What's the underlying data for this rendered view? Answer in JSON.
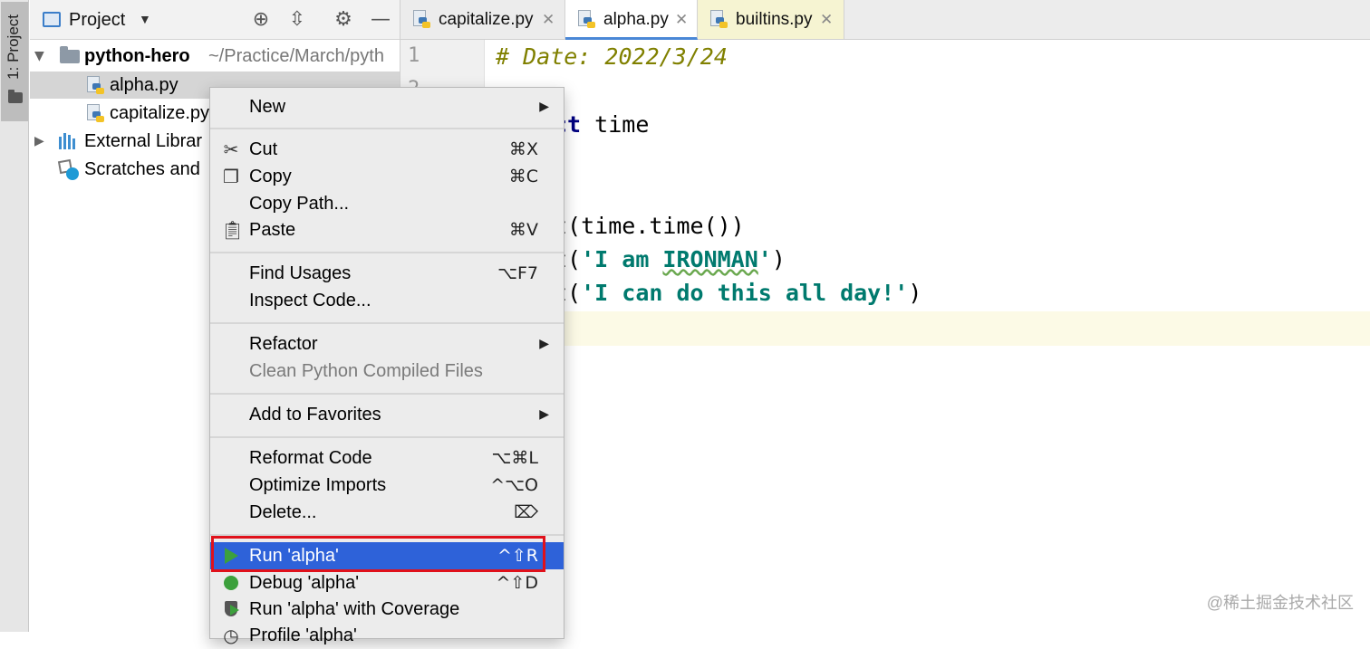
{
  "tool_window": {
    "label": "1: Project"
  },
  "project_panel": {
    "title": "Project",
    "tree": [
      {
        "name": "python-hero",
        "path": "~/Practice/March/pyth"
      },
      {
        "name": "alpha.py"
      },
      {
        "name": "capitalize.py"
      },
      {
        "name": "External Librar"
      },
      {
        "name": "Scratches and"
      }
    ]
  },
  "tabs": [
    {
      "label": "capitalize.py"
    },
    {
      "label": "alpha.py"
    },
    {
      "label": "builtins.py"
    }
  ],
  "editor": {
    "line_numbers": [
      "1",
      "2"
    ],
    "code": {
      "comment": "# Date: 2022/3/24",
      "import_kw": "ct",
      "import_rest": " time",
      "print1_rest": "t(time.time())",
      "print2_tail": "t(",
      "print2_str_a": "'I am ",
      "print2_str_b": "IRONMAN",
      "print2_str_c": "'",
      "print2_close": ")",
      "print3_tail": "t(",
      "print3_str": "'I can do this all day!'",
      "print3_close": ")"
    }
  },
  "context_menu": {
    "items": {
      "new": {
        "label": "New"
      },
      "cut": {
        "label": "Cut",
        "shortcut": "⌘X"
      },
      "copy": {
        "label": "Copy",
        "shortcut": "⌘C"
      },
      "copy_path": {
        "label": "Copy Path..."
      },
      "paste": {
        "label": "Paste",
        "shortcut": "⌘V"
      },
      "find_usages": {
        "label": "Find Usages",
        "shortcut": "⌥F7"
      },
      "inspect_code": {
        "label": "Inspect Code..."
      },
      "refactor": {
        "label": "Refactor"
      },
      "clean_compiled": {
        "label": "Clean Python Compiled Files"
      },
      "add_favorites": {
        "label": "Add to Favorites"
      },
      "reformat": {
        "label": "Reformat Code",
        "shortcut": "⌥⌘L"
      },
      "optimize_imports": {
        "label": "Optimize Imports",
        "shortcut": "^⌥O"
      },
      "delete": {
        "label": "Delete...",
        "shortcut": "⌦"
      },
      "run": {
        "label": "Run 'alpha'",
        "shortcut": "^⇧R"
      },
      "debug": {
        "label": "Debug 'alpha'",
        "shortcut": "^⇧D"
      },
      "run_coverage": {
        "label": "Run 'alpha' with Coverage"
      },
      "profile": {
        "label": "Profile 'alpha'"
      }
    }
  },
  "watermark": "@稀土掘金技术社区",
  "colors": {
    "highlight": "#2e62d9",
    "annotation_box": "#e0111b",
    "run_green": "#3ca03c"
  }
}
